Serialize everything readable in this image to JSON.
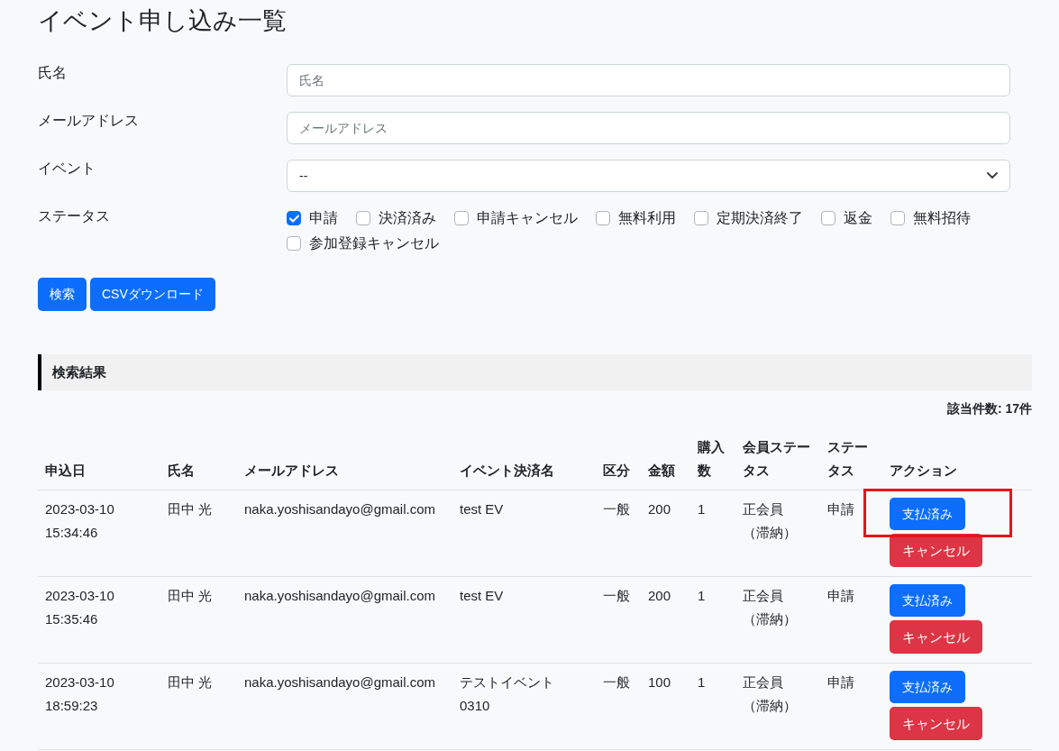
{
  "title": "イベント申し込み一覧",
  "form": {
    "fields": [
      {
        "kind": "text",
        "label": "氏名",
        "placeholder": "氏名"
      },
      {
        "kind": "text",
        "label": "メールアドレス",
        "placeholder": "メールアドレス"
      },
      {
        "kind": "select",
        "label": "イベント",
        "value": "--"
      }
    ],
    "status_label": "ステータス",
    "statuses": [
      {
        "label": "申請",
        "checked": true
      },
      {
        "label": "決済済み",
        "checked": false
      },
      {
        "label": "申請キャンセル",
        "checked": false
      },
      {
        "label": "無料利用",
        "checked": false
      },
      {
        "label": "定期決済終了",
        "checked": false
      },
      {
        "label": "返金",
        "checked": false
      },
      {
        "label": "無料招待",
        "checked": false
      },
      {
        "label": "参加登録キャンセル",
        "checked": false
      }
    ],
    "buttons": [
      "検索",
      "CSVダウンロード"
    ]
  },
  "results": {
    "heading": "検索結果",
    "count": "該当件数: 17件",
    "columns": [
      "申込日",
      "氏名",
      "メールアドレス",
      "イベント決済名",
      "区分",
      "金額",
      "購入数",
      "会員ステータス",
      "ステータス",
      "アクション"
    ],
    "rows": [
      {
        "date": "2023-03-10\n15:34:46",
        "name": "田中 光",
        "email": "naka.yoshisandayo@gmail.com",
        "event": "test EV",
        "category": "一般",
        "amount": "200",
        "quantity": "1",
        "member_status": "正会員（滞納）",
        "status": "申請",
        "actions": [
          "支払済み",
          "キャンセル"
        ],
        "highlighted": true
      },
      {
        "date": "2023-03-10\n15:35:46",
        "name": "田中 光",
        "email": "naka.yoshisandayo@gmail.com",
        "event": "test EV",
        "category": "一般",
        "amount": "200",
        "quantity": "1",
        "member_status": "正会員（滞納）",
        "status": "申請",
        "actions": [
          "支払済み",
          "キャンセル"
        ],
        "highlighted": false
      },
      {
        "date": "2023-03-10\n18:59:23",
        "name": "田中 光",
        "email": "naka.yoshisandayo@gmail.com",
        "event": "テストイベント\n0310",
        "category": "一般",
        "amount": "100",
        "quantity": "1",
        "member_status": "正会員（滞納）",
        "status": "申請",
        "actions": [
          "支払済み",
          "キャンセル"
        ],
        "highlighted": false
      }
    ]
  }
}
